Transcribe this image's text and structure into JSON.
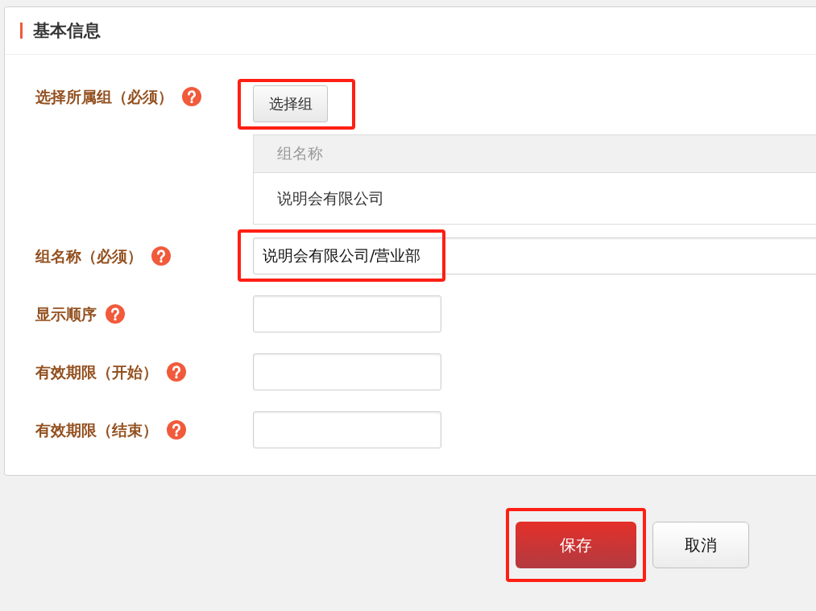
{
  "section": {
    "title": "基本信息"
  },
  "fields": [
    {
      "kind": "group-picker",
      "label": "选择所属组（必须）",
      "button": "选择组",
      "highlighted": true,
      "table": {
        "columns": [
          "组名称"
        ],
        "rows": [
          [
            "说明会有限公司"
          ]
        ]
      }
    },
    {
      "kind": "long-text",
      "label": "组名称（必须）",
      "value": "说明会有限公司/营业部",
      "highlighted": true
    },
    {
      "kind": "short-text",
      "label": "显示顺序",
      "highlighted": false
    },
    {
      "kind": "short-text",
      "label": "有效期限（开始）",
      "highlighted": false
    },
    {
      "kind": "short-text",
      "label": "有效期限（结束）",
      "highlighted": false
    }
  ],
  "actions": [
    {
      "kind": "primary",
      "label": "保存",
      "highlighted": true
    },
    {
      "kind": "secondary",
      "label": "取消",
      "highlighted": false
    }
  ]
}
